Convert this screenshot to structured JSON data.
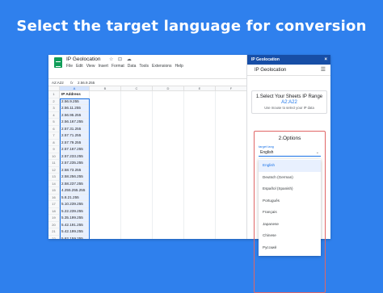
{
  "banner": {
    "title": "Select the target language for conversion"
  },
  "sheets": {
    "doc_title": "IP Geolocation",
    "title_icons": "☆ ⊡ ☁",
    "menu": [
      "File",
      "Edit",
      "View",
      "Insert",
      "Format",
      "Data",
      "Tools",
      "Extensions",
      "Help"
    ],
    "name_box": "A2:A22",
    "fx_symbol": "fx",
    "formula_value": "2.56.9.255",
    "column_headers": [
      "A",
      "B",
      "C",
      "D",
      "E",
      "F"
    ],
    "row_numbers": [
      "1",
      "2",
      "3",
      "4",
      "5",
      "6",
      "7",
      "8",
      "9",
      "10",
      "11",
      "12",
      "13",
      "14",
      "15",
      "16",
      "17",
      "18",
      "19",
      "20",
      "21",
      "22",
      "23"
    ],
    "header_cell": "IP Address",
    "ip_values": [
      "2.56.9.255",
      "2.56.11.255",
      "2.56.95.255",
      "2.56.167.255",
      "2.57.31.255",
      "2.57.71.255",
      "2.57.79.255",
      "2.57.167.255",
      "2.57.233.255",
      "2.57.235.255",
      "2.58.73.255",
      "2.58.256.255",
      "2.58.237.255",
      "4.255.255.255",
      "5.8.21.255",
      "5.10.239.255",
      "5.22.239.255",
      "5.35.199.255",
      "5.42.191.255",
      "5.42.199.255",
      "5.62.159.255"
    ]
  },
  "panel": {
    "top_title": "IP Geolocation",
    "close_icon": "×",
    "sub_title": "IP Geolocation",
    "menu_icon": "☰",
    "step1": {
      "title": "1.Select Your Sheets IP Range",
      "range": "A2:A22",
      "hint": "Use mouse to select your IP data"
    },
    "step2": {
      "title": "2.Options",
      "target_label": "target lang",
      "selected": "English",
      "chevron": "⌄",
      "options": [
        "English",
        "Deutsch (German)",
        "Español (Spanish)",
        "Português",
        "Français",
        "Japanese",
        "Chinese",
        "Русский"
      ]
    }
  },
  "colors": {
    "background": "#2f80ed",
    "accent": "#1a73e8",
    "panel_header": "#174ea6",
    "highlight_border": "#e06666"
  }
}
